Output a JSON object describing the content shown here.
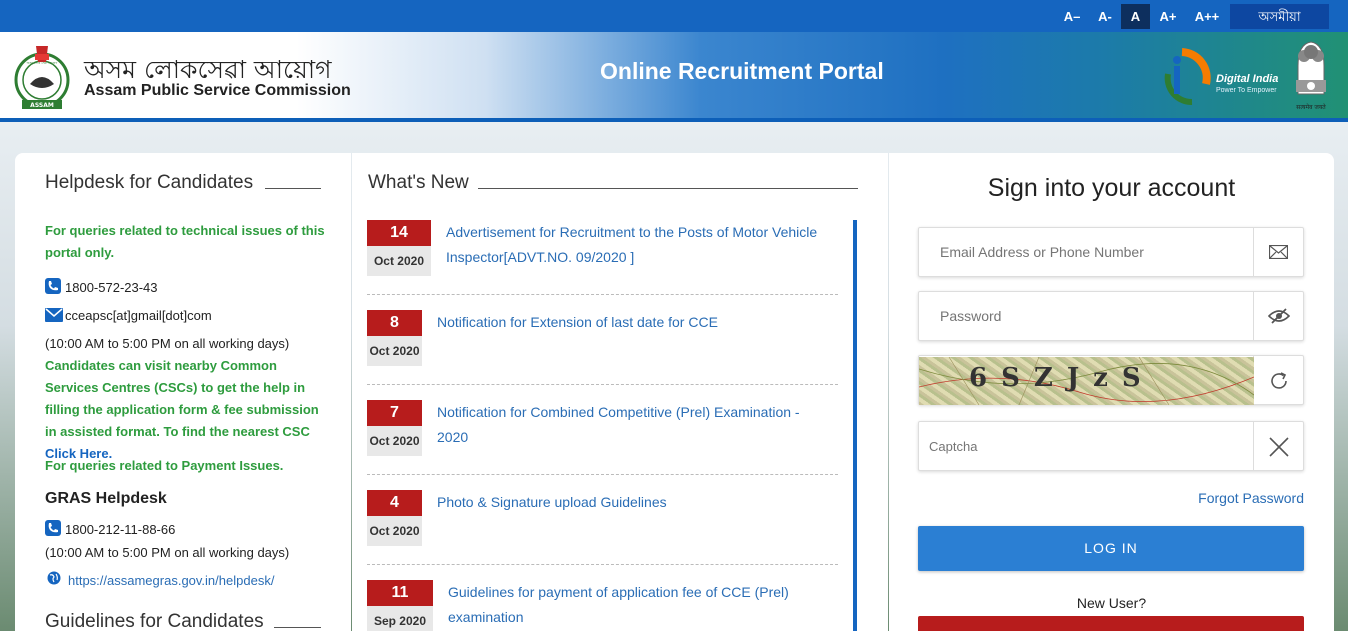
{
  "topbar": {
    "font_sizes": [
      "A–",
      "A-",
      "A",
      "A+",
      "A++"
    ],
    "active_font": "A",
    "language_label": "অসমীয়া"
  },
  "header": {
    "org_name_assamese": "অসম লোকসেৱা আয়োগ",
    "org_name_english": "Assam Public Service Commission",
    "portal_title": "Online Recruitment Portal",
    "digital_india": "Digital India",
    "digital_india_tagline": "Power To Empower",
    "emblem_caption": "सत्यमेव जयते",
    "emblem_ring_text": "অসম লোক সেৱা আয়োগ",
    "emblem_base_text": "ASSAM"
  },
  "helpdesk": {
    "title": "Helpdesk for Candidates",
    "tech_query": "For queries related to technical issues of this portal only.",
    "phone": "1800-572-23-43",
    "email": "cceapsc[at]gmail[dot]com",
    "hours": "(10:00 AM to 5:00 PM on all working days)",
    "csc_text": "Candidates can visit nearby Common Services Centres (CSCs) to get the help in filling the application form & fee submission in assisted format. To find the nearest CSC",
    "csc_link": "Click Here.",
    "payment_query": "For queries related to Payment Issues.",
    "gras_title": "GRAS Helpdesk",
    "gras_phone": "1800-212-11-88-66",
    "gras_hours": "(10:00 AM to 5:00 PM on all working days)",
    "gras_link": "https://assamegras.gov.in/helpdesk/",
    "guidelines_title": "Guidelines for Candidates"
  },
  "whats_new": {
    "title": "What's New",
    "items": [
      {
        "day": "14",
        "month": "Oct 2020",
        "text": "Advertisement for Recruitment to the Posts of Motor Vehicle Inspector[ADVT.NO. 09/2020 ]"
      },
      {
        "day": "8",
        "month": "Oct 2020",
        "text": "Notification for Extension of last date for CCE"
      },
      {
        "day": "7",
        "month": "Oct 2020",
        "text": "Notification for Combined Competitive (Prel) Examination - 2020"
      },
      {
        "day": "4",
        "month": "Oct 2020",
        "text": "Photo & Signature upload Guidelines"
      },
      {
        "day": "11",
        "month": "Sep 2020",
        "text": "Guidelines for payment of application fee of CCE (Prel) examination"
      }
    ]
  },
  "signin": {
    "title": "Sign into your account",
    "email_placeholder": "Email Address or Phone Number",
    "password_placeholder": "Password",
    "captcha_text": "6SZJzS",
    "captcha_placeholder": "Captcha",
    "forgot": "Forgot Password",
    "login": "LOG IN",
    "new_user": "New User?"
  },
  "colors": {
    "topbar": "#1565c0",
    "date_red": "#b71c1c",
    "link_blue": "#2a6db5",
    "green": "#2e9c3e",
    "login_blue": "#2b7fd3"
  }
}
